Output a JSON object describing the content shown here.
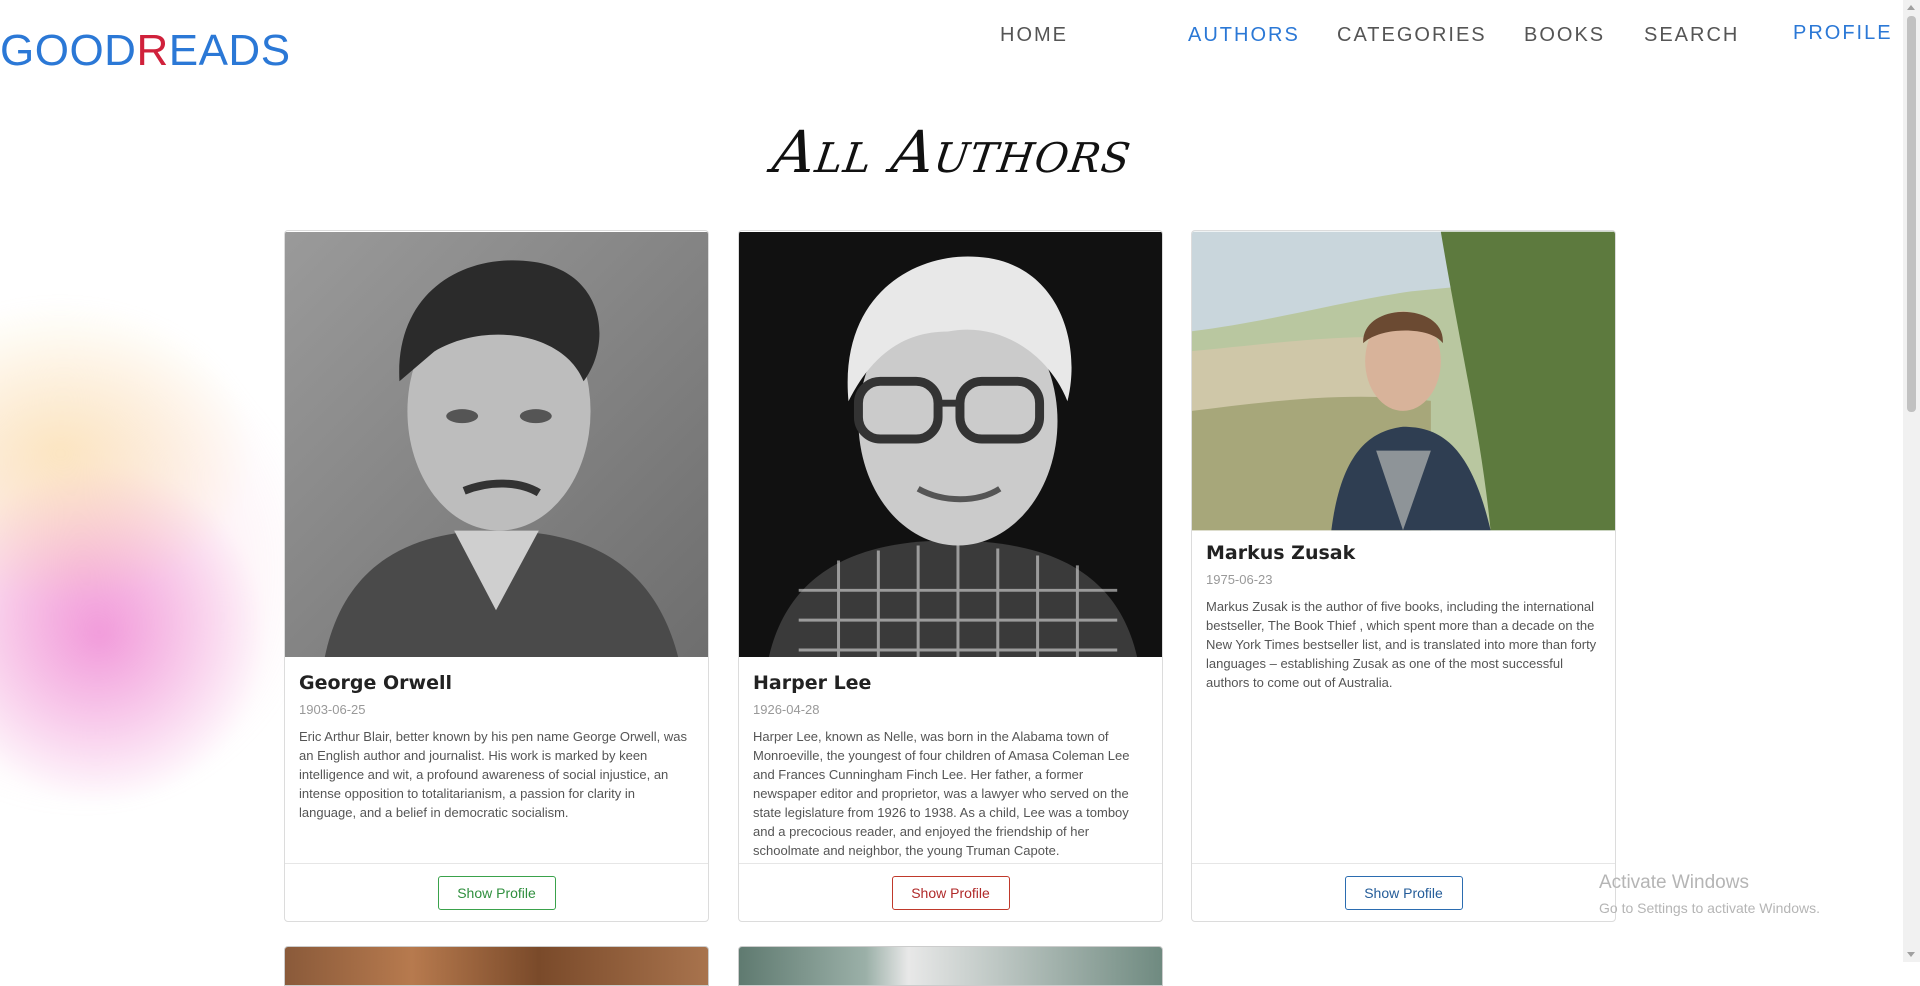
{
  "logo": {
    "part1": "GOOD",
    "part2": "R",
    "part3": "EADS"
  },
  "nav": {
    "home": "HOME",
    "authors": "AUTHORS",
    "categories": "CATEGORIES",
    "books": "BOOKS",
    "search": "SEARCH",
    "profile": "PROFILE",
    "active": "AUTHORS"
  },
  "page_title": "All Authors",
  "authors": [
    {
      "name": "George Orwell",
      "date": "1903-06-25",
      "bio": "Eric Arthur Blair, better known by his pen name George Orwell, was an English author and journalist. His work is marked by keen intelligence and wit, a profound awareness of social injustice, an intense opposition to totalitarianism, a passion for clarity in language, and a belief in democratic socialism.",
      "button": "Show Profile",
      "button_color": "#3aa24b"
    },
    {
      "name": "Harper Lee",
      "date": "1926-04-28",
      "bio": "Harper Lee, known as Nelle, was born in the Alabama town of Monroeville, the youngest of four children of Amasa Coleman Lee and Frances Cunningham Finch Lee. Her father, a former newspaper editor and proprietor, was a lawyer who served on the state legislature from 1926 to 1938. As a child, Lee was a tomboy and a precocious reader, and enjoyed the friendship of her schoolmate and neighbor, the young Truman Capote.",
      "button": "Show Profile",
      "button_color": "#c0392b"
    },
    {
      "name": "Markus Zusak",
      "date": "1975-06-23",
      "bio": "Markus Zusak is the author of five books, including the international bestseller, The Book Thief , which spent more than a decade on the New York Times bestseller list, and is translated into more than forty languages – establishing Zusak as one of the most successful authors to come out of Australia.",
      "button": "Show Profile",
      "button_color": "#2b6cb0"
    }
  ],
  "watermark": {
    "line1": "Activate Windows",
    "line2": "Go to Settings to activate Windows."
  },
  "colors": {
    "accent": "#2b78d6",
    "logo_red": "#d0213b",
    "nav_text": "#555555"
  }
}
